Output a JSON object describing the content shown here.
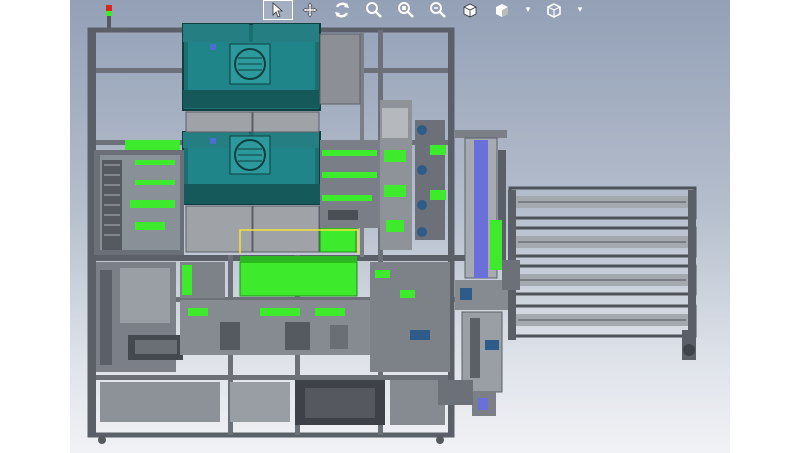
{
  "app": {
    "title": ""
  },
  "toolbar": {
    "items": [
      {
        "name": "select-tool-icon",
        "active": true
      },
      {
        "name": "pan-icon"
      },
      {
        "name": "rotate-view-icon"
      },
      {
        "name": "zoom-to-fit-icon"
      },
      {
        "name": "zoom-to-area-icon"
      },
      {
        "name": "zoom-in-out-icon"
      },
      {
        "name": "standard-views-icon"
      },
      {
        "name": "display-style-icon"
      },
      {
        "name": "display-style-dropdown-icon"
      },
      {
        "name": "hide-show-items-icon"
      },
      {
        "name": "hide-show-dropdown-icon"
      }
    ]
  },
  "colors": {
    "frame": "#5b6068",
    "frame_light": "#9aa0a8",
    "fan_unit": "#1e7d7f",
    "green_parts": "#3dea2c",
    "conveyor_blue": "#6a6fd9",
    "panel_gray": "#8f949a",
    "selection_yellow": "#f0e33a",
    "signal_red": "#d8261f"
  }
}
